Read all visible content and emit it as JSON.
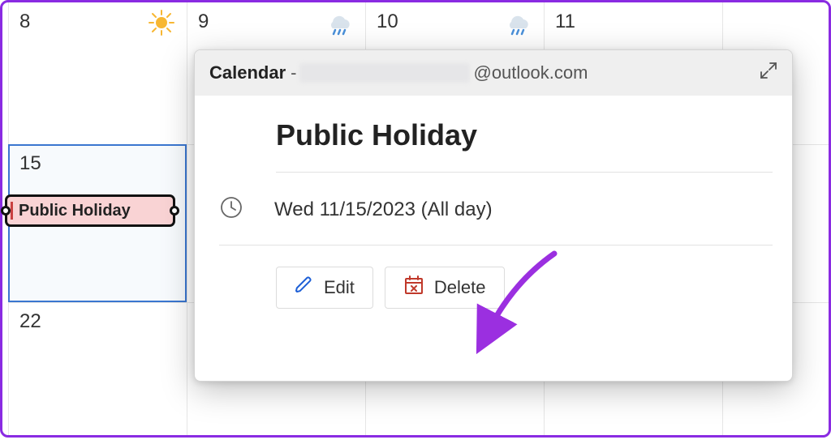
{
  "calendar": {
    "days": {
      "d8": "8",
      "d9": "9",
      "d10": "10",
      "d11": "11",
      "d15": "15",
      "d22": "22"
    },
    "event_pill_label": "Public Holiday"
  },
  "popup": {
    "calendar_label": "Calendar",
    "dash": " - ",
    "email_suffix": "@outlook.com",
    "event_title": "Public Holiday",
    "date_text": "Wed 11/15/2023 (All day)",
    "edit_label": "Edit",
    "delete_label": "Delete"
  },
  "icons": {
    "sun": "sun-icon",
    "rain": "rain-icon",
    "expand": "expand-icon",
    "clock": "clock-icon",
    "pencil": "pencil-icon",
    "calendar_x": "calendar-x-icon"
  },
  "colors": {
    "accent_purple": "#8a2be2",
    "event_bg": "#f9d3d4",
    "delete_red": "#c0392b",
    "edit_blue": "#1d5fd6"
  }
}
